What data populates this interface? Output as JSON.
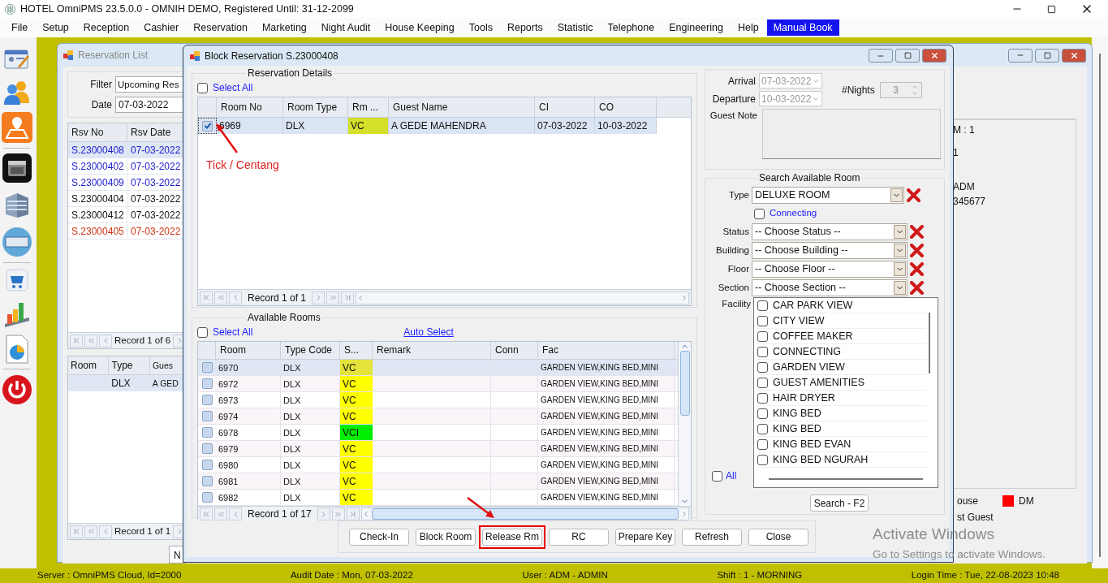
{
  "window": {
    "title": "HOTEL OmniPMS 23.5.0.0 - OMNIH DEMO, Registered Until: 31-12-2099"
  },
  "menu": [
    {
      "label": "File",
      "selected": false
    },
    {
      "label": "Setup",
      "selected": false
    },
    {
      "label": "Reception",
      "selected": false
    },
    {
      "label": "Cashier",
      "selected": false
    },
    {
      "label": "Reservation",
      "selected": false
    },
    {
      "label": "Marketing",
      "selected": false
    },
    {
      "label": "Night Audit",
      "selected": false
    },
    {
      "label": "House Keeping",
      "selected": false
    },
    {
      "label": "Tools",
      "selected": false
    },
    {
      "label": "Reports",
      "selected": false
    },
    {
      "label": "Statistic",
      "selected": false
    },
    {
      "label": "Telephone",
      "selected": false
    },
    {
      "label": "Engineering",
      "selected": false
    },
    {
      "label": "Help",
      "selected": false
    },
    {
      "label": "Manual Book",
      "selected": true
    }
  ],
  "reservation_list": {
    "title": "Reservation List",
    "filter_label": "Filter",
    "filter_value": "Upcoming Res",
    "date_label": "Date",
    "date_value": "07-03-2022",
    "columns": [
      "Rsv No",
      "Rsv Date"
    ],
    "rows": [
      {
        "cells": [
          "S.23000408",
          "07-03-2022"
        ],
        "color": "#1a1acc",
        "selected": true
      },
      {
        "cells": [
          "S.23000402",
          "07-03-2022"
        ],
        "color": "#1a1acc",
        "selected": false
      },
      {
        "cells": [
          "S.23000409",
          "07-03-2022"
        ],
        "color": "#1a1acc",
        "selected": false
      },
      {
        "cells": [
          "S.23000404",
          "07-03-2022"
        ],
        "color": "#111111",
        "selected": false
      },
      {
        "cells": [
          "S.23000412",
          "07-03-2022"
        ],
        "color": "#111111",
        "selected": false
      },
      {
        "cells": [
          "S.23000405",
          "07-03-2022"
        ],
        "color": "#cc3311",
        "selected": false
      }
    ],
    "record": "Record 1 of 6",
    "room_columns": [
      "Room",
      "Type",
      "Gues"
    ],
    "room_rows": [
      [
        "",
        "DLX",
        "A GED"
      ]
    ],
    "room_record": "Record 1 of 1",
    "tab": "N",
    "side_texts": [
      "M : 1",
      "1",
      "ADM",
      "345677"
    ],
    "legend": [
      {
        "label": "ouse"
      },
      {
        "label": "DM",
        "color": "#ff0000"
      },
      {
        "label": "st Guest"
      }
    ]
  },
  "block": {
    "title": "Block Reservation S.23000408",
    "details": {
      "legend": "Reservation Details",
      "select_all": {
        "label": "Select All",
        "checked": false
      },
      "columns": [
        "Room No",
        "Room Type",
        "Rm ...",
        "Guest Name",
        "CI",
        "CO"
      ],
      "rows": [
        {
          "checked": true,
          "selected": true,
          "cells": [
            "6969",
            "DLX",
            "VC",
            "A GEDE MAHENDRA",
            "07-03-2022",
            "10-03-2022"
          ],
          "color": "#d4e02a"
        }
      ],
      "record": "Record 1 of 1"
    },
    "available": {
      "legend": "Available Rooms",
      "select_all": {
        "label": "Select All",
        "checked": false
      },
      "auto_select": "Auto Select",
      "columns": [
        "Room",
        "Type Code",
        "S...",
        "Remark",
        "Conn",
        "Fac"
      ],
      "rows": [
        {
          "checked": false,
          "selected": true,
          "cells": [
            "6970",
            "DLX",
            "VC",
            "",
            "",
            "GARDEN VIEW,KING BED,MINI"
          ],
          "color": "#e3e33a"
        },
        {
          "checked": false,
          "selected": false,
          "cells": [
            "6972",
            "DLX",
            "VC",
            "",
            "",
            "GARDEN VIEW,KING BED,MINI"
          ],
          "color": "#ffff00"
        },
        {
          "checked": false,
          "selected": false,
          "cells": [
            "6973",
            "DLX",
            "VC",
            "",
            "",
            "GARDEN VIEW,KING BED,MINI"
          ],
          "color": "#ffff00"
        },
        {
          "checked": false,
          "selected": false,
          "cells": [
            "6974",
            "DLX",
            "VC",
            "",
            "",
            "GARDEN VIEW,KING BED,MINI"
          ],
          "color": "#ffff00"
        },
        {
          "checked": false,
          "selected": false,
          "cells": [
            "6978",
            "DLX",
            "VCI",
            "",
            "",
            "GARDEN VIEW,KING BED,MINI"
          ],
          "color": "#00ee00"
        },
        {
          "checked": false,
          "selected": false,
          "cells": [
            "6979",
            "DLX",
            "VC",
            "",
            "",
            "GARDEN VIEW,KING BED,MINI"
          ],
          "color": "#ffff00"
        },
        {
          "checked": false,
          "selected": false,
          "cells": [
            "6980",
            "DLX",
            "VC",
            "",
            "",
            "GARDEN VIEW,KING BED,MINI"
          ],
          "color": "#ffff00"
        },
        {
          "checked": false,
          "selected": false,
          "cells": [
            "6981",
            "DLX",
            "VC",
            "",
            "",
            "GARDEN VIEW,KING BED,MINI"
          ],
          "color": "#ffff00"
        },
        {
          "checked": false,
          "selected": false,
          "cells": [
            "6982",
            "DLX",
            "VC",
            "",
            "",
            "GARDEN VIEW,KING BED,MINI"
          ],
          "color": "#ffff00"
        }
      ],
      "record": "Record 1 of 17"
    },
    "stay": {
      "arrival_label": "Arrival",
      "arrival": "07-03-2022",
      "departure_label": "Departure",
      "departure": "10-03-2022",
      "nights_label": "#Nights",
      "nights": "3",
      "guest_note_label": "Guest Note"
    },
    "search": {
      "legend": "Search Available Room",
      "filters": [
        {
          "label": "Type",
          "value": "DELUXE ROOM"
        },
        {
          "label": "Status",
          "value": "-- Choose Status --"
        },
        {
          "label": "Building",
          "value": "-- Choose Building --"
        },
        {
          "label": "Floor",
          "value": "-- Choose Floor --"
        },
        {
          "label": "Section",
          "value": "-- Choose Section --"
        }
      ],
      "connecting": {
        "label": "Connecting",
        "checked": false
      },
      "facility_label": "Facility",
      "facilities": [
        {
          "label": "CAR PARK VIEW",
          "checked": false
        },
        {
          "label": "CITY VIEW",
          "checked": false
        },
        {
          "label": "COFFEE MAKER",
          "checked": false
        },
        {
          "label": "CONNECTING",
          "checked": false
        },
        {
          "label": "GARDEN VIEW",
          "checked": false
        },
        {
          "label": "GUEST AMENITIES",
          "checked": false
        },
        {
          "label": "HAIR DRYER",
          "checked": false
        },
        {
          "label": "KING BED",
          "checked": false
        },
        {
          "label": "KING BED",
          "checked": false
        },
        {
          "label": "KING BED EVAN",
          "checked": false
        },
        {
          "label": "KING BED NGURAH",
          "checked": false
        }
      ],
      "all": {
        "label": "All",
        "checked": false
      },
      "search_button": "Search - F2"
    },
    "buttons": [
      {
        "label": "Check-In",
        "highlighted": false
      },
      {
        "label": "Block Room",
        "highlighted": false
      },
      {
        "label": "Release Rm",
        "highlighted": true
      },
      {
        "label": "RC",
        "highlighted": false
      },
      {
        "label": "Prepare Key",
        "highlighted": false
      },
      {
        "label": "Refresh",
        "highlighted": false
      },
      {
        "label": "Close",
        "highlighted": false
      }
    ]
  },
  "annotation": {
    "text": "Tick / Centang"
  },
  "activation": {
    "title": "Activate Windows",
    "subtitle": "Go to Settings to activate Windows."
  },
  "status_bar": [
    "Server : OmniPMS Cloud, Id=2000",
    "Audit Date : Mon, 07-03-2022",
    "User : ADM - ADMIN",
    "Shift : 1 - MORNING",
    "Login Time : Tue, 22-08-2023 10:48"
  ]
}
